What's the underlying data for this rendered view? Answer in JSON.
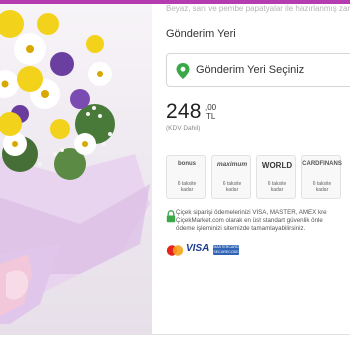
{
  "header": {
    "description": "Beyaz, sarı ve pembe papatyalar ile hazırlanmış zarif"
  },
  "delivery": {
    "title": "Gönderim Yeri",
    "select_placeholder": "Gönderim Yeri Seçiniz",
    "icon": "location-pin-icon"
  },
  "price": {
    "integer": "248",
    "decimal": ",00",
    "currency": "TL",
    "vat_note": "(KDV Dahil)"
  },
  "installment_cards": [
    {
      "brand": "bonus",
      "line1": "6 taksite",
      "line2": "kadar"
    },
    {
      "brand": "maximum",
      "line1": "6 taksite",
      "line2": "kadar"
    },
    {
      "brand": "WORLD",
      "line1": "6 taksite",
      "line2": "kadar"
    },
    {
      "brand": "CARDFINANS",
      "line1": "6 taksite",
      "line2": "kadar"
    }
  ],
  "security": {
    "lines": [
      "Çiçek siparişi ödemelerinizi VISA, MASTER, AMEX kre",
      "ÇiçekMarket.com olarak en üst standart güvenlik önle",
      "ödeme işleminizi sitemizde tamamlayabilirsiniz."
    ],
    "icon": "lock-icon"
  },
  "payment_logos": {
    "visa": "VISA",
    "badge_line1": "MASTERCARD",
    "badge_line2": "SECURECODE"
  },
  "colors": {
    "brand": "#b43bb0",
    "pin_green": "#3aa847",
    "lock_green": "#3aa847"
  }
}
